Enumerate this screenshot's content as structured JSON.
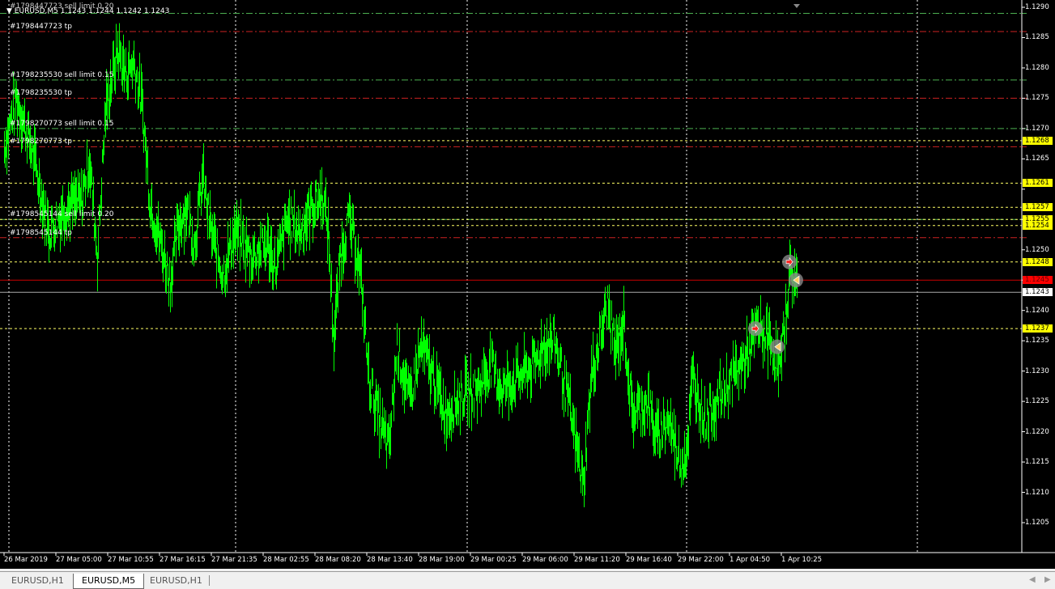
{
  "header": {
    "symbol_info": "EURUSD,M5  1.1243 1.1244 1.1242 1.1243",
    "hidden_order_label": "#1798447723 sell limit 0.20"
  },
  "orders": [
    {
      "label": "#1798447723 sell limit 0.20",
      "price": 1.1289,
      "type": "sell-limit",
      "show": false
    },
    {
      "label": "#1798447723 tp",
      "price": 1.1286,
      "type": "tp",
      "show": true
    },
    {
      "label": "#1798235530 sell limit 0.15",
      "price": 1.1278,
      "type": "sell-limit",
      "show": true
    },
    {
      "label": "#1798235530 tp",
      "price": 1.1275,
      "type": "tp",
      "show": true
    },
    {
      "label": "#1798270773 sell limit 0.15",
      "price": 1.127,
      "type": "sell-limit",
      "show": true
    },
    {
      "label": "#1798270773 tp",
      "price": 1.1267,
      "type": "tp",
      "show": true
    },
    {
      "label": "#1798545144 sell limit 0.20",
      "price": 1.1255,
      "type": "sell-limit",
      "show": true
    },
    {
      "label": "#1798545144 tp",
      "price": 1.1252,
      "type": "tp",
      "show": true
    }
  ],
  "price_axis": {
    "max": 1.129,
    "min": 1.1205,
    "step": 0.0005,
    "highlighted": [
      {
        "text": "1.1268",
        "price": 1.1268,
        "color": "#ffff00"
      },
      {
        "text": "1.1261",
        "price": 1.1261,
        "color": "#ffff00"
      },
      {
        "text": "1.1257",
        "price": 1.1257,
        "color": "#ffff00"
      },
      {
        "text": "1.1255",
        "price": 1.1255,
        "color": "#ffff00"
      },
      {
        "text": "1.1254",
        "price": 1.1254,
        "color": "#ffff00"
      },
      {
        "text": "1.1248",
        "price": 1.1248,
        "color": "#ffff00"
      },
      {
        "text": "1.1245",
        "price": 1.1245,
        "color": "#ff0000"
      },
      {
        "text": "1.1243",
        "price": 1.1243,
        "color": "#ffffff"
      },
      {
        "text": "1.1237",
        "price": 1.1237,
        "color": "#ffff00"
      }
    ]
  },
  "time_axis": [
    "26 Mar 2019",
    "27 Mar 05:00",
    "27 Mar 10:55",
    "27 Mar 16:15",
    "27 Mar 21:35",
    "28 Mar 02:55",
    "28 Mar 08:20",
    "28 Mar 13:40",
    "28 Mar 19:00",
    "29 Mar 00:25",
    "29 Mar 06:00",
    "29 Mar 11:20",
    "29 Mar 16:40",
    "29 Mar 22:00",
    "1 Apr 04:50",
    "1 Apr 10:25"
  ],
  "colors": {
    "bars": "#00ff00",
    "sell_limit": "#4caf50",
    "tp": "#cc2222",
    "level": "#ffff66",
    "bid": "#ff0000",
    "ask": "#aaaaaa",
    "grid": "#ffffff"
  },
  "chart_data": {
    "type": "bar",
    "symbol": "EURUSD",
    "timeframe": "M5",
    "series": [
      [
        5,
        1.1267
      ],
      [
        20,
        1.1275
      ],
      [
        40,
        1.1266
      ],
      [
        60,
        1.1253
      ],
      [
        80,
        1.1257
      ],
      [
        100,
        1.1258
      ],
      [
        110,
        1.1265
      ],
      [
        120,
        1.1249
      ],
      [
        130,
        1.1273
      ],
      [
        145,
        1.1283
      ],
      [
        155,
        1.1279
      ],
      [
        165,
        1.1281
      ],
      [
        175,
        1.1274
      ],
      [
        185,
        1.1258
      ],
      [
        200,
        1.125
      ],
      [
        210,
        1.1245
      ],
      [
        220,
        1.1254
      ],
      [
        230,
        1.1257
      ],
      [
        240,
        1.1251
      ],
      [
        250,
        1.1262
      ],
      [
        260,
        1.1253
      ],
      [
        275,
        1.1246
      ],
      [
        290,
        1.1253
      ],
      [
        310,
        1.1249
      ],
      [
        330,
        1.1251
      ],
      [
        340,
        1.1247
      ],
      [
        355,
        1.1255
      ],
      [
        370,
        1.1253
      ],
      [
        385,
        1.1257
      ],
      [
        398,
        1.1259
      ],
      [
        405,
        1.1253
      ],
      [
        412,
        1.1235
      ],
      [
        420,
        1.1249
      ],
      [
        430,
        1.1255
      ],
      [
        440,
        1.125
      ],
      [
        447,
        1.1243
      ],
      [
        455,
        1.1229
      ],
      [
        470,
        1.1221
      ],
      [
        480,
        1.1217
      ],
      [
        490,
        1.1234
      ],
      [
        505,
        1.1225
      ],
      [
        520,
        1.1234
      ],
      [
        535,
        1.1229
      ],
      [
        550,
        1.1223
      ],
      [
        570,
        1.1226
      ],
      [
        590,
        1.1227
      ],
      [
        605,
        1.1231
      ],
      [
        620,
        1.1227
      ],
      [
        640,
        1.1229
      ],
      [
        660,
        1.1231
      ],
      [
        670,
        1.1234
      ],
      [
        685,
        1.1235
      ],
      [
        700,
        1.1226
      ],
      [
        715,
        1.1215
      ],
      [
        720,
        1.1211
      ],
      [
        730,
        1.1229
      ],
      [
        740,
        1.1235
      ],
      [
        750,
        1.1241
      ],
      [
        760,
        1.1233
      ],
      [
        770,
        1.1238
      ],
      [
        780,
        1.1223
      ],
      [
        800,
        1.1225
      ],
      [
        810,
        1.1219
      ],
      [
        825,
        1.1222
      ],
      [
        840,
        1.1215
      ],
      [
        848,
        1.1217
      ],
      [
        855,
        1.1229
      ],
      [
        870,
        1.1222
      ],
      [
        890,
        1.1226
      ],
      [
        905,
        1.1229
      ],
      [
        920,
        1.1232
      ],
      [
        935,
        1.1237
      ],
      [
        950,
        1.1235
      ],
      [
        963,
        1.123
      ],
      [
        975,
        1.1246
      ],
      [
        985,
        1.1245
      ]
    ],
    "trades": [
      {
        "price": 1.1248,
        "bar": 975,
        "kind": "sell"
      },
      {
        "price": 1.1245,
        "bar": 983,
        "kind": "close"
      },
      {
        "price": 1.1237,
        "bar": 933,
        "kind": "sell"
      },
      {
        "price": 1.1234,
        "bar": 960,
        "kind": "close"
      }
    ]
  },
  "tabs": [
    {
      "label": "EURUSD,H1",
      "active": false
    },
    {
      "label": "EURUSD,M5",
      "active": true
    },
    {
      "label": "EURUSD,H1",
      "active": false
    }
  ]
}
